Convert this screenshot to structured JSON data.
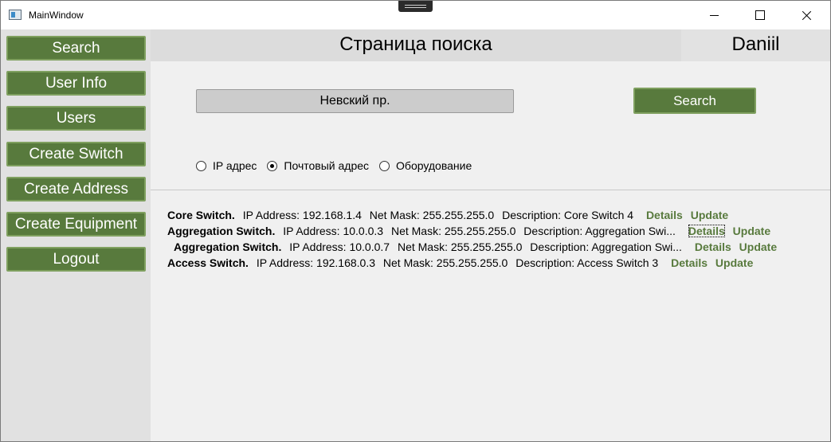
{
  "window": {
    "title": "MainWindow"
  },
  "sidebar": {
    "items": [
      {
        "label": "Search"
      },
      {
        "label": "User Info"
      },
      {
        "label": "Users"
      },
      {
        "label": "Create Switch"
      },
      {
        "label": "Create Address"
      },
      {
        "label": "Create Equipment"
      },
      {
        "label": "Logout"
      }
    ]
  },
  "header": {
    "title": "Страница поиска",
    "user": "Daniil"
  },
  "search": {
    "query": "Невский пр.",
    "button_label": "Search",
    "options": [
      {
        "label": "IP адрес",
        "checked": false
      },
      {
        "label": "Почтовый адрес",
        "checked": true
      },
      {
        "label": "Оборудование",
        "checked": false
      }
    ]
  },
  "results": [
    {
      "name": "Core Switch.",
      "ip": "IP Address: 192.168.1.4",
      "mask": "Net Mask: 255.255.255.0",
      "description": "Description: Core Switch 4",
      "details": "Details",
      "update": "Update"
    },
    {
      "name": "Aggregation Switch.",
      "ip": "IP Address: 10.0.0.3",
      "mask": "Net Mask: 255.255.255.0",
      "description": "Description: Aggregation Swi...",
      "details": "Details",
      "update": "Update"
    },
    {
      "name": "Aggregation Switch.",
      "ip": "IP Address: 10.0.0.7",
      "mask": "Net Mask: 255.255.255.0",
      "description": "Description: Aggregation Swi...",
      "details": "Details",
      "update": "Update"
    },
    {
      "name": "Access Switch.",
      "ip": "IP Address: 192.168.0.3",
      "mask": "Net Mask: 255.255.255.0",
      "description": "Description: Access Switch 3",
      "details": "Details",
      "update": "Update"
    }
  ]
}
